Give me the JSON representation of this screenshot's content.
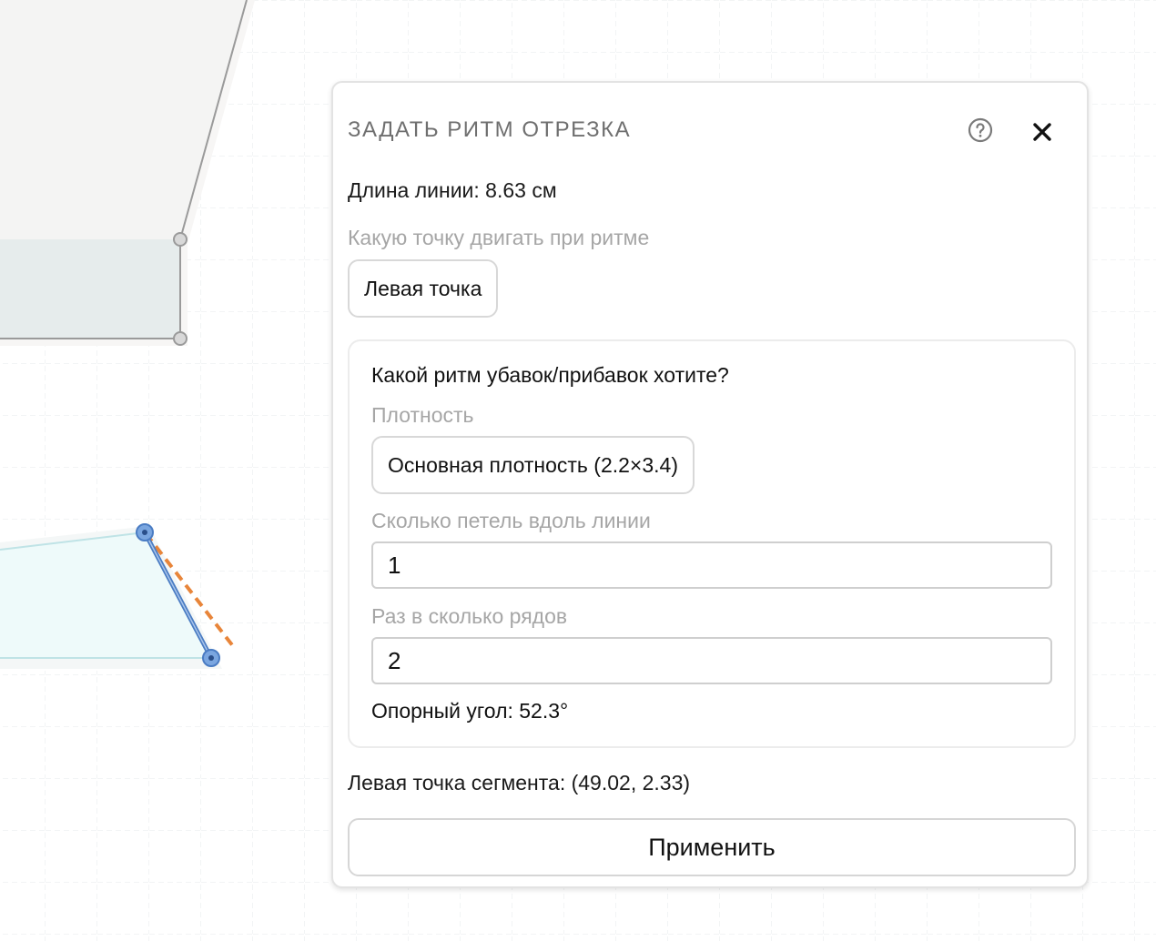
{
  "canvas": {
    "grid_color": "#eef0f2",
    "shape_upper_fill": "#f4f4f3",
    "shape_upper_band_fill": "#e6ecec",
    "shape_upper_stroke": "#9a9a9a",
    "shape_lower_fill": "#eefafa",
    "shape_lower_stroke": "#bfe3e6",
    "selected_segment_color": "#4a7cc3",
    "guide_line_color": "#e8853a",
    "handle_fill": "#d8d8d8",
    "handle_stroke": "#9a9a9a"
  },
  "dialog": {
    "title": "ЗАДАТЬ РИТМ ОТРЕЗКА",
    "help_icon": "help-circle-icon",
    "close_icon": "close-icon",
    "line_length": "Длина линии: 8.63 см",
    "move_point_label": "Какую точку двигать при ритме",
    "move_point_value": "Левая точка",
    "rhythm": {
      "title": "Какой ритм убавок/прибавок хотите?",
      "density_label": "Плотность",
      "density_value": "Основная плотность (2.2×3.4)",
      "loops_label": "Сколько петель вдоль линии",
      "loops_value": "1",
      "rows_label": "Раз в сколько рядов",
      "rows_value": "2",
      "reference_angle": "Опорный угол: 52.3°"
    },
    "segment_left_point": "Левая точка сегмента: (49.02, 2.33)",
    "apply_label": "Применить"
  }
}
